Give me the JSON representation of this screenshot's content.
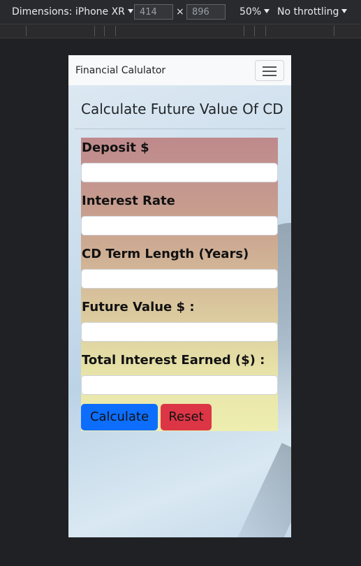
{
  "devtools": {
    "dimensions_label": "Dimensions: iPhone XR",
    "width_value": "414",
    "height_value": "896",
    "times": "×",
    "zoom": "50%",
    "throttling": "No throttling"
  },
  "app": {
    "brand": "Financial Calulator",
    "page_title": "Calculate Future Value Of CD"
  },
  "form": {
    "deposit_label": "Deposit $",
    "interest_label": "Interest Rate",
    "term_label": "CD Term Length (Years)",
    "future_value_label": "Future Value $ :",
    "total_interest_label": "Total Interest Earned ($) :",
    "deposit_value": "",
    "interest_value": "",
    "term_value": "",
    "future_value_value": "",
    "total_interest_value": "",
    "calculate_label": "Calculate",
    "reset_label": "Reset"
  },
  "colors": {
    "primary": "#0d6efd",
    "danger": "#dc3545",
    "navbar_bg": "#f8f9fa"
  },
  "icons": {
    "menu": "hamburger-icon",
    "dropdown": "caret-down-icon"
  }
}
